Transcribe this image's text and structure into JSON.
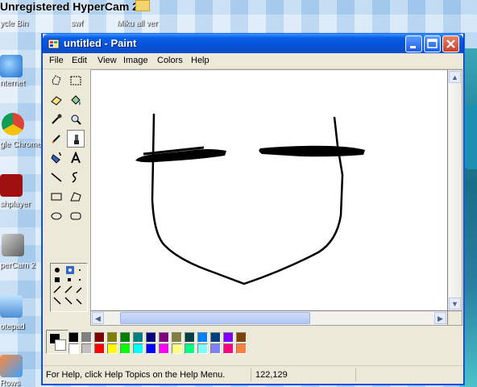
{
  "desktop": {
    "watermark": "Unregistered HyperCam 2",
    "icons": [
      {
        "label": "ycle Bin"
      },
      {
        "label": "nternet"
      },
      {
        "label": "gle Chrome"
      },
      {
        "label": "shplayer"
      },
      {
        "label": "perCam 2"
      },
      {
        "label": "otepad"
      },
      {
        "label": "Rows"
      }
    ],
    "top_labels": [
      "swf",
      "Miku all ver"
    ]
  },
  "window": {
    "title": "untitled - Paint",
    "menu": [
      "File",
      "Edit",
      "View",
      "Image",
      "Colors",
      "Help"
    ]
  },
  "tools": [
    "free-form-select-icon",
    "select-icon",
    "eraser-icon",
    "fill-icon",
    "pick-color-icon",
    "magnifier-icon",
    "pencil-icon",
    "brush-icon",
    "airbrush-icon",
    "text-icon",
    "line-icon",
    "curve-icon",
    "rectangle-icon",
    "polygon-icon",
    "ellipse-icon",
    "rounded-rectangle-icon"
  ],
  "palette": {
    "foreground": "#000000",
    "background": "#ffffff",
    "row1": [
      "#000000",
      "#808080",
      "#800000",
      "#808000",
      "#008000",
      "#008080",
      "#000080",
      "#800080",
      "#808040",
      "#004040",
      "#0080ff",
      "#004080",
      "#8000ff",
      "#804000"
    ],
    "row2": [
      "#ffffff",
      "#c0c0c0",
      "#ff0000",
      "#ffff00",
      "#00ff00",
      "#00ffff",
      "#0000ff",
      "#ff00ff",
      "#ffff80",
      "#00ff80",
      "#80ffff",
      "#8080ff",
      "#ff0080",
      "#ff8040"
    ]
  },
  "status": {
    "help_text": "For Help, click Help Topics on the Help Menu.",
    "coords": "122,129"
  }
}
